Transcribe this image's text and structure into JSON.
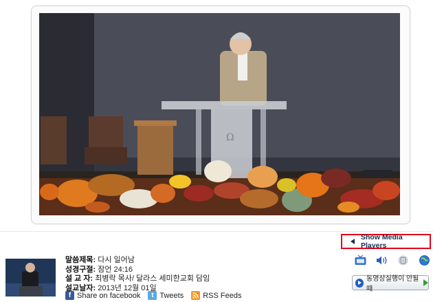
{
  "player": {
    "show_media_players_label": "Show Media Players"
  },
  "sermon": {
    "title_label": "말씀제목:",
    "title_value": "다시 일어남",
    "scripture_label": "성경구절:",
    "scripture_value": "잠언 24:16",
    "preacher_label": "설 교 자:",
    "preacher_value": "최병락 목사/ 달라스 세미한교회 담임",
    "date_label": "설교날자:",
    "date_value": "2013년 12월 01일"
  },
  "share": {
    "facebook_label": "Share on facebook",
    "twitter_label": "Tweets",
    "rss_label": "RSS Feeds",
    "facebook_icon": "f",
    "twitter_icon": "t"
  },
  "media": {
    "play_help_label": "동영상실행이 안될때",
    "icons": [
      "tv-icon",
      "speaker-icon",
      "document-icon",
      "globe-icon"
    ]
  },
  "colors": {
    "accent_red": "#e3001b",
    "nav_dark": "#1d2b4a",
    "facebook": "#3b5998",
    "twitter": "#5aa9e1",
    "rss": "#f7931e"
  }
}
